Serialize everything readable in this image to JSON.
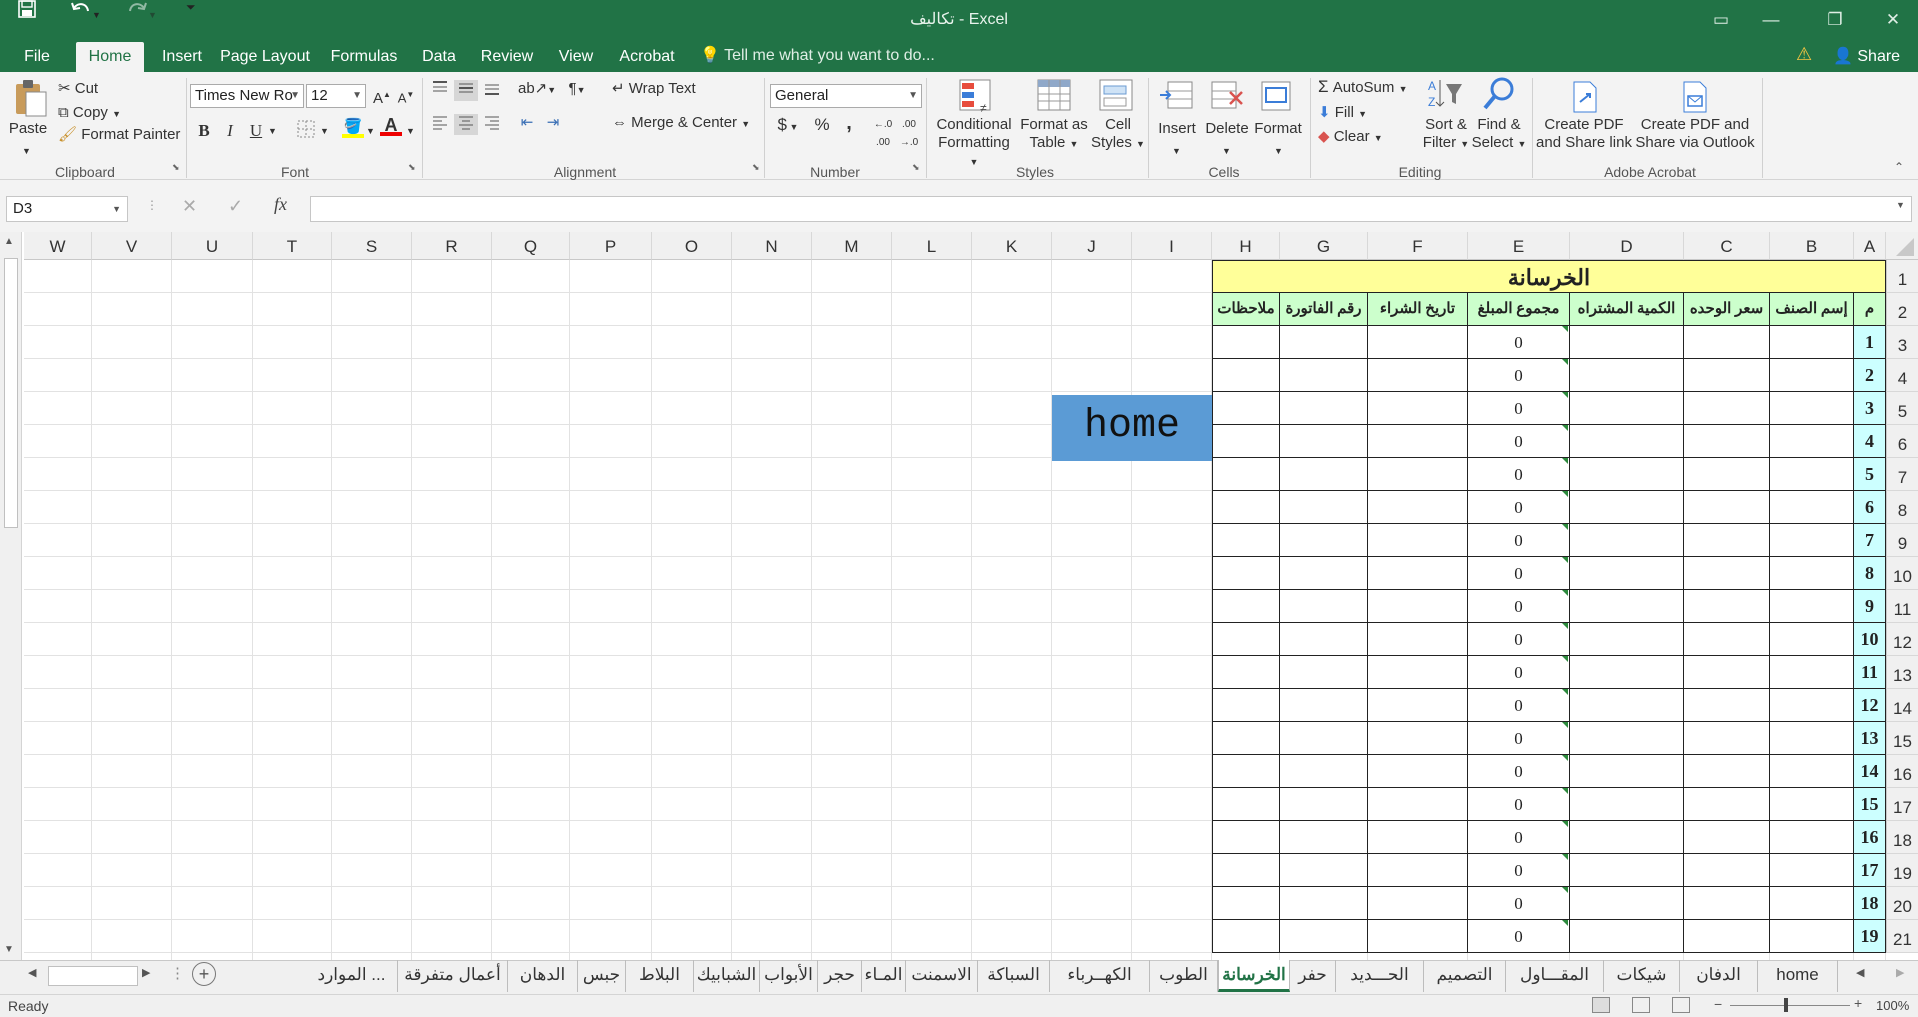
{
  "window": {
    "title": "تكاليف - Excel",
    "user_tab_share": "Share"
  },
  "ribbon_tabs": [
    "File",
    "Home",
    "Insert",
    "Page Layout",
    "Formulas",
    "Data",
    "Review",
    "View",
    "Acrobat"
  ],
  "active_tab": "Home",
  "tell_me": "Tell me what you want to do...",
  "clipboard": {
    "paste": "Paste",
    "cut": "Cut",
    "copy": "Copy",
    "format_painter": "Format Painter",
    "label": "Clipboard"
  },
  "font": {
    "family": "Times New Ro",
    "size": "12",
    "label": "Font",
    "bold": "B",
    "italic": "I",
    "underline": "U"
  },
  "alignment": {
    "wrap": "Wrap Text",
    "merge": "Merge & Center",
    "label": "Alignment"
  },
  "number": {
    "format": "General",
    "label": "Number",
    "currency": "$",
    "percent": "%",
    "comma": ","
  },
  "styles": {
    "conditional_1": "Conditional",
    "conditional_2": "Formatting",
    "format_table_1": "Format as",
    "format_table_2": "Table",
    "cell_styles_1": "Cell",
    "cell_styles_2": "Styles",
    "label": "Styles"
  },
  "cells": {
    "insert": "Insert",
    "delete": "Delete",
    "format": "Format",
    "label": "Cells"
  },
  "editing": {
    "autosum": "AutoSum",
    "fill": "Fill",
    "clear": "Clear",
    "sort_1": "Sort &",
    "sort_2": "Filter",
    "find_1": "Find &",
    "find_2": "Select",
    "label": "Editing"
  },
  "acrobat": {
    "create_share_1": "Create PDF",
    "create_share_2": "and Share link",
    "create_outlook_1": "Create PDF and",
    "create_outlook_2": "Share via Outlook",
    "label": "Adobe Acrobat"
  },
  "formula_bar": {
    "name_box": "D3",
    "fx": "fx",
    "value": ""
  },
  "columns": [
    "W",
    "V",
    "U",
    "T",
    "S",
    "R",
    "Q",
    "P",
    "O",
    "N",
    "M",
    "L",
    "K",
    "J",
    "I",
    "H",
    "G",
    "F",
    "E",
    "D",
    "C",
    "B",
    "A"
  ],
  "rows": [
    "1",
    "2",
    "3",
    "4",
    "5",
    "6",
    "7",
    "8",
    "9",
    "10",
    "11",
    "12",
    "13",
    "14",
    "15",
    "16",
    "17",
    "18",
    "19",
    "20",
    "21"
  ],
  "sheet": {
    "title": "الخرسانة",
    "headers": [
      "م",
      "إسم الصنف",
      "سعر الوحده",
      "الكمية المشتراه",
      "مجموع المبلغ",
      "تاريخ الشراء",
      "رقم الفاتورة",
      "ملاحظات"
    ],
    "row_numbers": [
      "1",
      "2",
      "3",
      "4",
      "5",
      "6",
      "7",
      "8",
      "9",
      "10",
      "11",
      "12",
      "13",
      "14",
      "15",
      "16",
      "17",
      "18",
      "19"
    ],
    "totals": [
      "0",
      "0",
      "0",
      "0",
      "0",
      "0",
      "0",
      "0",
      "0",
      "0",
      "0",
      "0",
      "0",
      "0",
      "0",
      "0",
      "0",
      "0",
      "0"
    ],
    "home_button": "home"
  },
  "sheet_tabs": [
    "home",
    "الدفان",
    "شيكات",
    "المقـــاول",
    "التصميم",
    "الحـــديد",
    "حفر",
    "الخرسانة",
    "الطوب",
    "الكهــرباء",
    "السباكة",
    "الاسمنت",
    "المـاء",
    "حجر",
    "الأبواب",
    "الشبابيك",
    "البلاط",
    "جبس",
    "الدهان",
    "أعمال متفرقة",
    "الموارد ..."
  ],
  "active_sheet": "الخرسانة",
  "status": {
    "ready": "Ready",
    "zoom": "100%"
  },
  "colors": {
    "accent": "#217346",
    "title_fill": "#ffff99",
    "header_fill": "#ccffcc",
    "number_fill": "#ccffff",
    "home_fill": "#5b9bd5"
  }
}
